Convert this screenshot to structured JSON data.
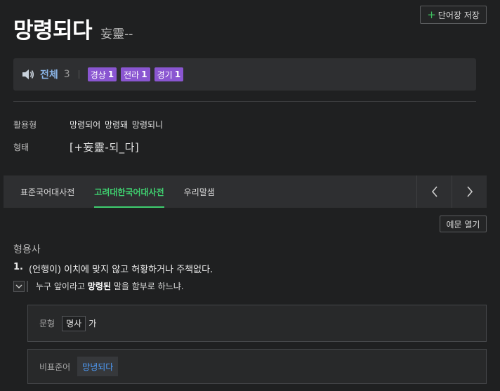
{
  "header": {
    "save_plus": "+",
    "save_label": "단어장 저장",
    "word": "망령되다",
    "hanja": "妄靈--"
  },
  "filter": {
    "all_label": "전체",
    "all_count": "3",
    "regions": [
      {
        "name": "경상",
        "count": "1"
      },
      {
        "name": "전라",
        "count": "1"
      },
      {
        "name": "경기",
        "count": "1"
      }
    ],
    "region_color": "#8a56d1"
  },
  "info": {
    "conj_label": "활용형",
    "conj_value": "망령되어 망령돼 망령되니",
    "form_label": "형태",
    "form_value": "[+妄靈-되_다]"
  },
  "tabs": [
    {
      "label": "표준국어대사전",
      "active": false
    },
    {
      "label": "고려대한국어대사전",
      "active": true
    },
    {
      "label": "우리말샘",
      "active": false
    }
  ],
  "accent": "#3fcf6f",
  "example_toggle_label": "예문 열기",
  "entry": {
    "pos": "형용사",
    "sense_num": "1.",
    "sense_text": "(언행이) 이치에 맞지 않고 허황하거나 주책없다.",
    "example_pre": "누구 앞이라고 ",
    "example_bold": "망령된",
    "example_post": " 말을 함부로 하느냐."
  },
  "pattern": {
    "label": "문형",
    "chip": "명사",
    "tail": "가"
  },
  "nonstandard": {
    "label": "비표준어",
    "link": "망녕되다",
    "link_color": "#4f9fff"
  }
}
